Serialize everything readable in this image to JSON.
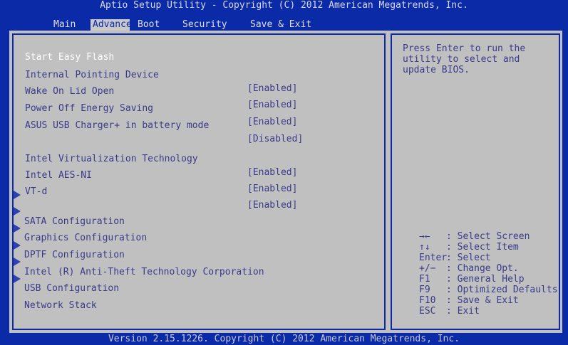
{
  "title": "Aptio Setup Utility - Copyright (C) 2012 American Megatrends, Inc.",
  "tabs": [
    {
      "label": "Main",
      "active": false
    },
    {
      "label": "Advance",
      "active": true
    },
    {
      "label": "Boot",
      "active": false
    },
    {
      "label": "Security",
      "active": false
    },
    {
      "label": "Save & Exit",
      "active": false
    }
  ],
  "settings": [
    {
      "label": "Start Easy Flash",
      "value": "",
      "selected": true
    },
    {
      "label": "Internal Pointing Device",
      "value": "[Enabled]"
    },
    {
      "label": "Wake On Lid Open",
      "value": "[Enabled]"
    },
    {
      "label": "Power Off Energy Saving",
      "value": "[Enabled]"
    },
    {
      "label": "ASUS USB Charger+ in battery mode",
      "value": "[Disabled]"
    },
    {
      "label": "Intel Virtualization Technology",
      "value": "[Enabled]"
    },
    {
      "label": "Intel AES-NI",
      "value": "[Enabled]"
    },
    {
      "label": "VT-d",
      "value": "[Enabled]"
    }
  ],
  "submenus": [
    {
      "label": "SATA Configuration"
    },
    {
      "label": "Graphics Configuration"
    },
    {
      "label": "DPTF Configuration"
    },
    {
      "label": "Intel (R) Anti-Theft Technology Corporation"
    },
    {
      "label": "USB Configuration"
    },
    {
      "label": "Network Stack"
    }
  ],
  "help": "Press Enter to run the\nutility to select and\nupdate BIOS.",
  "keys": [
    {
      "key": "→←",
      "desc": ": Select Screen"
    },
    {
      "key": "↑↓",
      "desc": ": Select Item"
    },
    {
      "key": "Enter",
      "desc": ": Select"
    },
    {
      "key": "+/−",
      "desc": ": Change Opt."
    },
    {
      "key": "F1",
      "desc": ": General Help"
    },
    {
      "key": "F9",
      "desc": ": Optimized Defaults"
    },
    {
      "key": "F10",
      "desc": ": Save & Exit"
    },
    {
      "key": "ESC",
      "desc": ": Exit"
    }
  ],
  "version": "Version 2.15.1226. Copyright (C) 2012 American Megatrends, Inc."
}
